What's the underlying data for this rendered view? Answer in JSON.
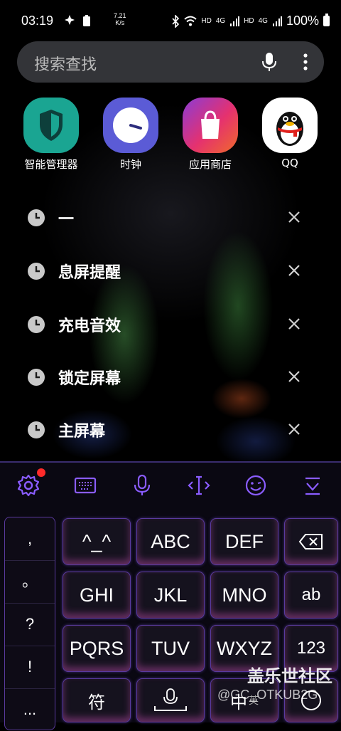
{
  "status_bar": {
    "time": "03:19",
    "speed_value": "7.21",
    "speed_unit": "K/s",
    "battery": "100%",
    "network_label_1": "HD",
    "network_label_2": "4G",
    "network_label_3": "HD",
    "network_label_4": "4G"
  },
  "search": {
    "placeholder": "搜索查找"
  },
  "apps": [
    {
      "label": "智能管理器",
      "color": "#1aa592"
    },
    {
      "label": "时钟",
      "color": "#5b5bd6"
    },
    {
      "label": "应用商店",
      "color": "#e5316f"
    },
    {
      "label": "QQ",
      "color": "#ffffff"
    }
  ],
  "history": [
    {
      "text": "一"
    },
    {
      "text": "息屏提醒"
    },
    {
      "text": "充电音效"
    },
    {
      "text": "锁定屏幕"
    },
    {
      "text": "主屏幕"
    }
  ],
  "keyboard": {
    "accent_color": "#8a5cff",
    "symbols": [
      ",",
      "。",
      "?",
      "!",
      "..."
    ],
    "rows": [
      [
        "^_^",
        "ABC",
        "DEF"
      ],
      [
        "GHI",
        "JKL",
        "MNO",
        "ab"
      ],
      [
        "PQRS",
        "TUV",
        "WXYZ",
        "123"
      ]
    ],
    "bottom": {
      "fu": "符",
      "zhong": "中",
      "ying": "英"
    }
  },
  "watermark": {
    "line1": "盖乐世社区",
    "line2": "@GC_OTKUB2G"
  }
}
